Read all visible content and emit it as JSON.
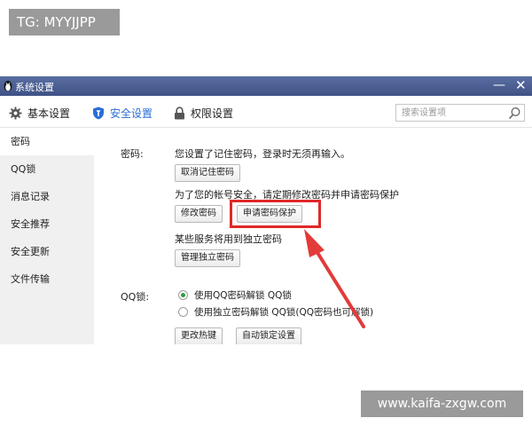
{
  "watermarks": {
    "top_left": "TG: MYYJJPP",
    "bottom_right": "www.kaifa-zxgw.com"
  },
  "window": {
    "title": "系统设置",
    "minimize": "—",
    "close": "✕"
  },
  "tabs": [
    {
      "label": "基本设置",
      "icon": "gear-icon",
      "active": false
    },
    {
      "label": "安全设置",
      "icon": "shield-icon",
      "active": true
    },
    {
      "label": "权限设置",
      "icon": "lock-icon",
      "active": false
    }
  ],
  "search": {
    "placeholder": "搜索设置项"
  },
  "sidebar": {
    "items": [
      {
        "label": "密码",
        "active": true
      },
      {
        "label": "QQ锁",
        "active": false
      },
      {
        "label": "消息记录",
        "active": false
      },
      {
        "label": "安全推荐",
        "active": false
      },
      {
        "label": "安全更新",
        "active": false
      },
      {
        "label": "文件传输",
        "active": false
      }
    ]
  },
  "password": {
    "label": "密码:",
    "status": "您设置了记住密码，登录时无须再输入。",
    "cancel_remember": "取消记住密码",
    "advice": "为了您的帐号安全，请定期修改密码并申请密码保护",
    "change_password": "修改密码",
    "apply_protection": "申请密码保护",
    "independent_note": "某些服务将用到独立密码",
    "manage_independent": "管理独立密码"
  },
  "qqlock": {
    "label": "QQ锁:",
    "option_qq": "使用QQ密码解锁 QQ锁",
    "option_independent": "使用独立密码解锁 QQ锁(QQ密码也可解锁)",
    "selected": "option_qq",
    "change_hotkey": "更改热键",
    "auto_lock": "自动锁定设置"
  },
  "colors": {
    "titlebar": "#4a5d92",
    "accent": "#2a6ed6",
    "highlight": "#e02828",
    "radio_on": "#2e9a3e"
  }
}
